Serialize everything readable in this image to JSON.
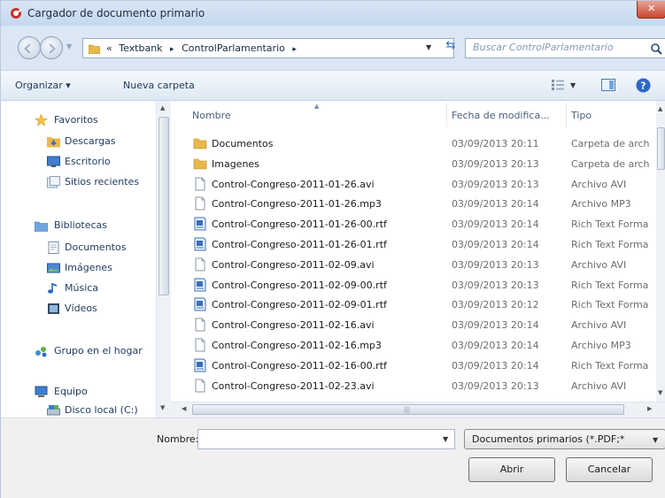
{
  "window": {
    "title": "Cargador de documento primario",
    "close_label": "✕"
  },
  "address": {
    "path_prefix": "«",
    "segments": [
      "Textbank",
      "ControlParlamentario"
    ],
    "separator": "▸",
    "search_placeholder": "Buscar ControlParlamentario"
  },
  "toolbar": {
    "organize_label": "Organizar ▾",
    "new_folder_label": "Nueva carpeta"
  },
  "sidebar": {
    "items": [
      {
        "label": "Favoritos",
        "icon": "star-icon"
      },
      {
        "label": "Descargas",
        "icon": "downloads-folder-icon"
      },
      {
        "label": "Escritorio",
        "icon": "desktop-icon"
      },
      {
        "label": "Sitios recientes",
        "icon": "recent-places-icon"
      },
      {
        "label": "Bibliotecas",
        "icon": "libraries-icon"
      },
      {
        "label": "Documentos",
        "icon": "documents-library-icon"
      },
      {
        "label": "Imágenes",
        "icon": "pictures-library-icon"
      },
      {
        "label": "Música",
        "icon": "music-library-icon"
      },
      {
        "label": "Vídeos",
        "icon": "videos-library-icon"
      },
      {
        "label": "Grupo en el hogar",
        "icon": "homegroup-icon"
      },
      {
        "label": "Equipo",
        "icon": "computer-icon"
      },
      {
        "label": "Disco local (C:)",
        "icon": "local-disk-icon"
      }
    ]
  },
  "columns": {
    "name": "Nombre",
    "date": "Fecha de modifica...",
    "type": "Tipo"
  },
  "files": [
    {
      "name": "Documentos",
      "date": "03/09/2013 20:11",
      "type": "Carpeta de arch",
      "icon": "folder-icon"
    },
    {
      "name": "Imagenes",
      "date": "03/09/2013 20:13",
      "type": "Carpeta de arch",
      "icon": "folder-icon"
    },
    {
      "name": "Control-Congreso-2011-01-26.avi",
      "date": "03/09/2013 20:13",
      "type": "Archivo AVI",
      "icon": "blank-file-icon"
    },
    {
      "name": "Control-Congreso-2011-01-26.mp3",
      "date": "03/09/2013 20:14",
      "type": "Archivo MP3",
      "icon": "blank-file-icon"
    },
    {
      "name": "Control-Congreso-2011-01-26-00.rtf",
      "date": "03/09/2013 20:14",
      "type": "Rich Text Forma",
      "icon": "rtf-file-icon"
    },
    {
      "name": "Control-Congreso-2011-01-26-01.rtf",
      "date": "03/09/2013 20:14",
      "type": "Rich Text Forma",
      "icon": "rtf-file-icon"
    },
    {
      "name": "Control-Congreso-2011-02-09.avi",
      "date": "03/09/2013 20:13",
      "type": "Archivo AVI",
      "icon": "blank-file-icon"
    },
    {
      "name": "Control-Congreso-2011-02-09-00.rtf",
      "date": "03/09/2013 20:13",
      "type": "Rich Text Forma",
      "icon": "rtf-file-icon"
    },
    {
      "name": "Control-Congreso-2011-02-09-01.rtf",
      "date": "03/09/2013 20:12",
      "type": "Rich Text Forma",
      "icon": "rtf-file-icon"
    },
    {
      "name": "Control-Congreso-2011-02-16.avi",
      "date": "03/09/2013 20:14",
      "type": "Archivo AVI",
      "icon": "blank-file-icon"
    },
    {
      "name": "Control-Congreso-2011-02-16.mp3",
      "date": "03/09/2013 20:14",
      "type": "Archivo MP3",
      "icon": "blank-file-icon"
    },
    {
      "name": "Control-Congreso-2011-02-16-00.rtf",
      "date": "03/09/2013 20:14",
      "type": "Rich Text Forma",
      "icon": "rtf-file-icon"
    },
    {
      "name": "Control-Congreso-2011-02-23.avi",
      "date": "03/09/2013 20:13",
      "type": "Archivo AVI",
      "icon": "blank-file-icon"
    }
  ],
  "bottom": {
    "name_label": "Nombre:",
    "name_value": "",
    "filter_value": "Documentos primarios (*.PDF;*",
    "open_label": "Abrir",
    "cancel_label": "Cancelar"
  },
  "colors": {
    "folder": "#e8b84a",
    "rtf": "#3a6fb8",
    "accent": "#1e395b"
  }
}
